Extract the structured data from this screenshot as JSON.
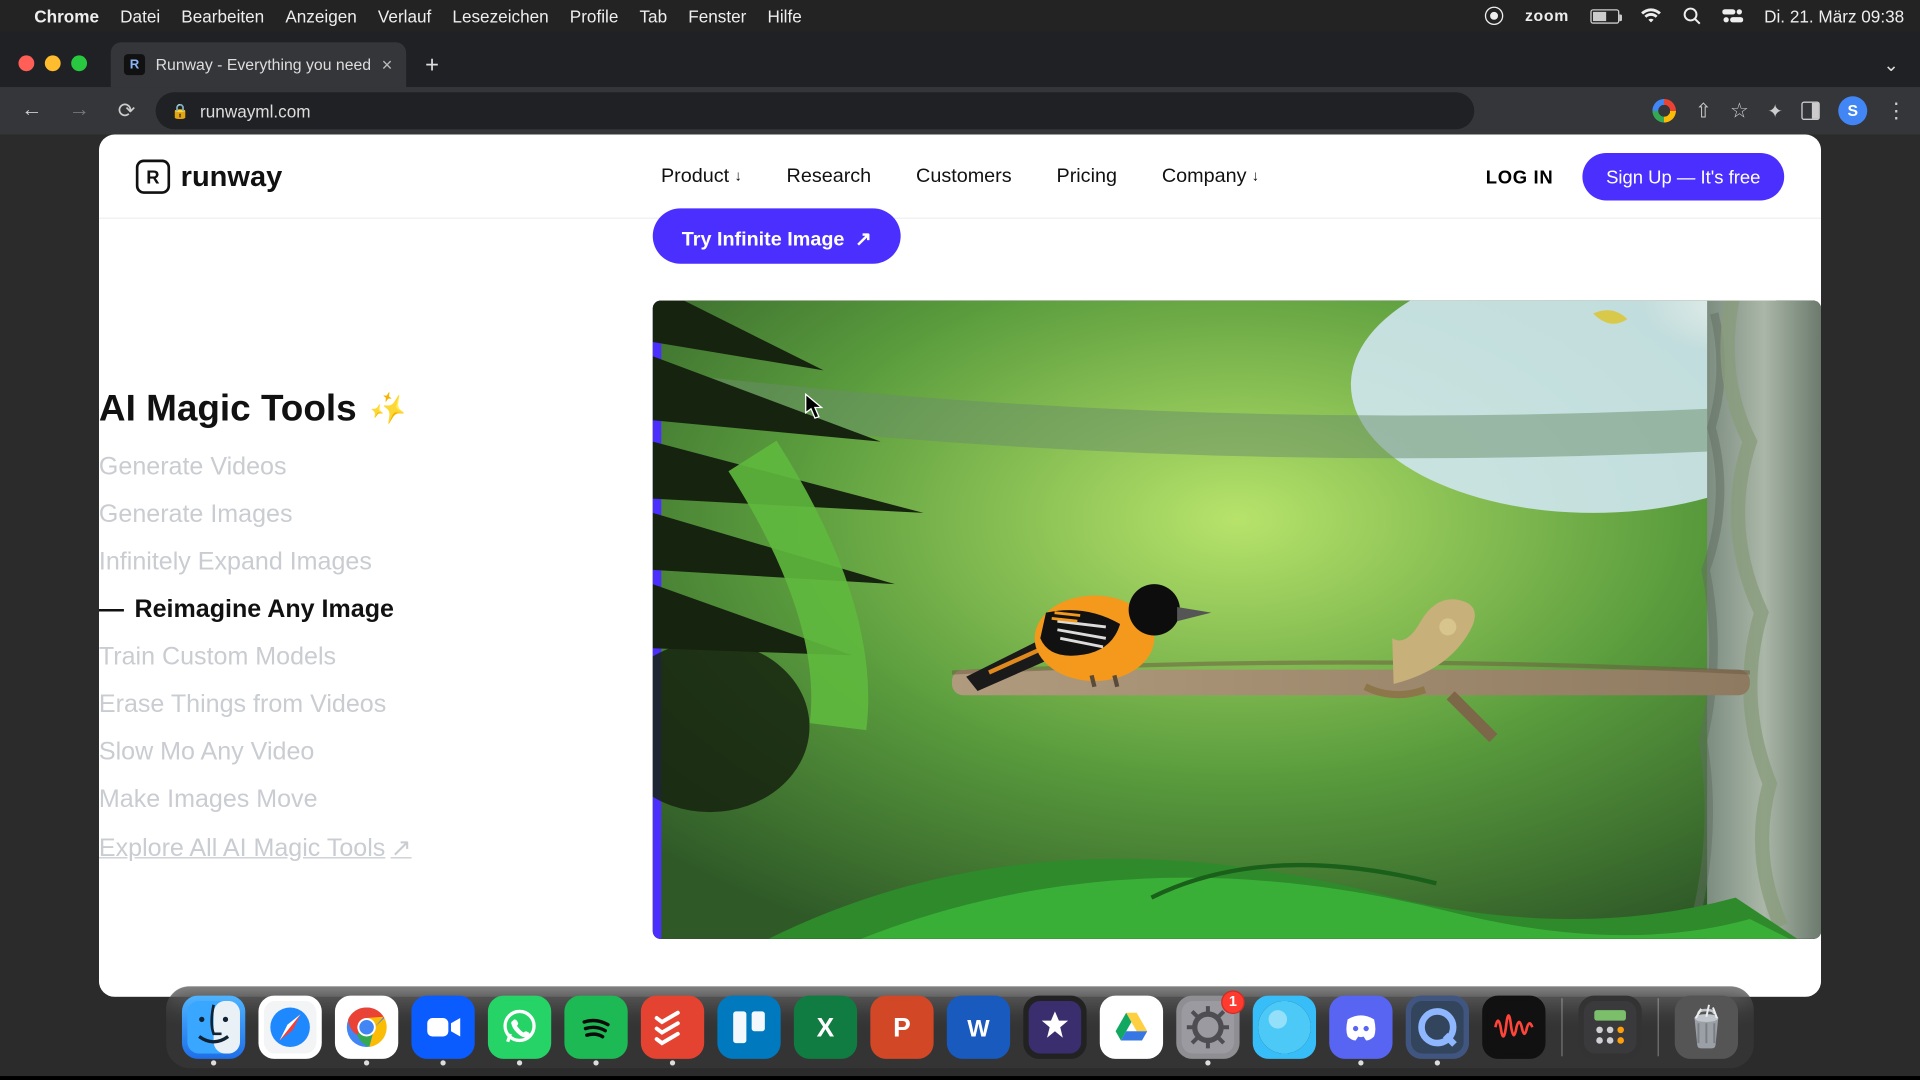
{
  "menubar": {
    "app": "Chrome",
    "items": [
      "Datei",
      "Bearbeiten",
      "Anzeigen",
      "Verlauf",
      "Lesezeichen",
      "Profile",
      "Tab",
      "Fenster",
      "Hilfe"
    ],
    "zoom": "zoom",
    "datetime": "Di. 21. März  09:38"
  },
  "browser": {
    "tab_title": "Runway - Everything you need",
    "url": "runwayml.com"
  },
  "header": {
    "logo_text": "runway",
    "nav": {
      "product": "Product",
      "research": "Research",
      "customers": "Customers",
      "pricing": "Pricing",
      "company": "Company"
    },
    "login": "LOG IN",
    "signup": "Sign Up — It's free"
  },
  "content": {
    "try_button": "Try Infinite Image",
    "section_title": "AI Magic Tools",
    "tools": [
      "Generate Videos",
      "Generate Images",
      "Infinitely Expand Images",
      "Reimagine Any Image",
      "Train Custom Models",
      "Erase Things from Videos",
      "Slow Mo Any Video",
      "Make Images Move"
    ],
    "active_index": 3,
    "explore": "Explore All AI Magic Tools"
  },
  "dock": {
    "settings_badge": "1"
  }
}
